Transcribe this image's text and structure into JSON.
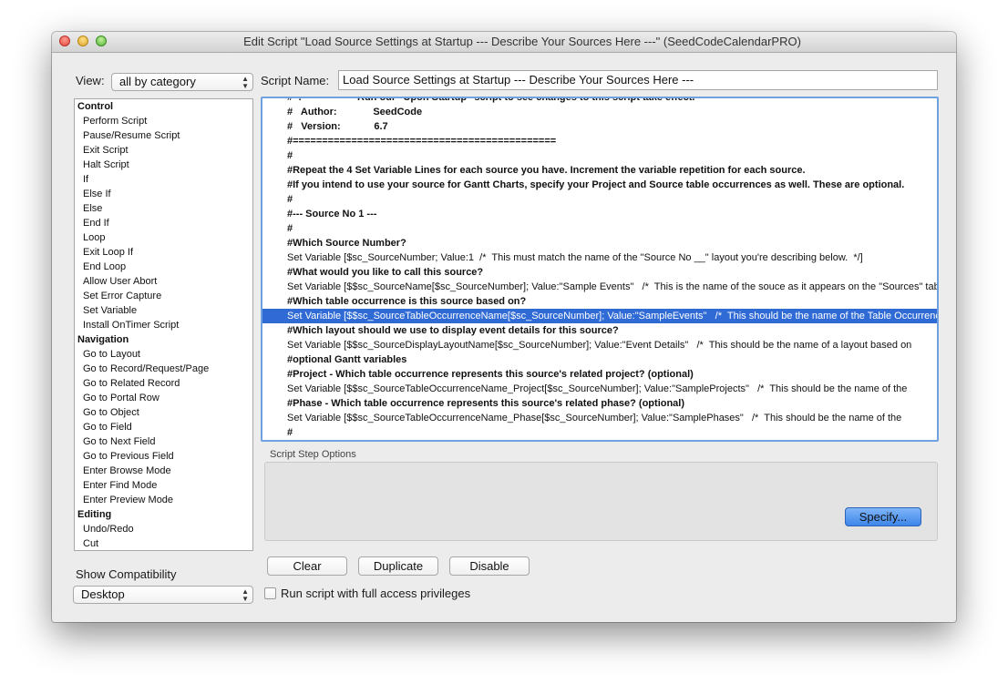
{
  "window": {
    "title": "Edit Script \"Load Source Settings at Startup --- Describe Your Sources Here ---\" (SeedCodeCalendarPRO)"
  },
  "view": {
    "label": "View:",
    "selected": "all by category"
  },
  "script_name": {
    "label": "Script Name:",
    "value": "Load Source Settings at Startup --- Describe Your Sources Here ---"
  },
  "steps": [
    {
      "label": "Control",
      "category": true
    },
    {
      "label": "Perform Script"
    },
    {
      "label": "Pause/Resume Script"
    },
    {
      "label": "Exit Script"
    },
    {
      "label": "Halt Script"
    },
    {
      "label": "If"
    },
    {
      "label": "Else If"
    },
    {
      "label": "Else"
    },
    {
      "label": "End If"
    },
    {
      "label": "Loop"
    },
    {
      "label": "Exit Loop If"
    },
    {
      "label": "End Loop"
    },
    {
      "label": "Allow User Abort"
    },
    {
      "label": "Set Error Capture"
    },
    {
      "label": "Set Variable"
    },
    {
      "label": "Install OnTimer Script"
    },
    {
      "label": "Navigation",
      "category": true
    },
    {
      "label": "Go to Layout"
    },
    {
      "label": "Go to Record/Request/Page"
    },
    {
      "label": "Go to Related Record"
    },
    {
      "label": "Go to Portal Row"
    },
    {
      "label": "Go to Object"
    },
    {
      "label": "Go to Field"
    },
    {
      "label": "Go to Next Field"
    },
    {
      "label": "Go to Previous Field"
    },
    {
      "label": "Enter Browse Mode"
    },
    {
      "label": "Enter Find Mode"
    },
    {
      "label": "Enter Preview Mode"
    },
    {
      "label": "Editing",
      "category": true
    },
    {
      "label": "Undo/Redo"
    },
    {
      "label": "Cut"
    }
  ],
  "script_lines": [
    {
      "text": "#  :                    Run our \"Upon Startup\" script to see changes to this script take effect.",
      "bold": true
    },
    {
      "text": "#   Author:             SeedCode",
      "bold": true
    },
    {
      "text": "#   Version:            6.7",
      "bold": true
    },
    {
      "text": "#=============================================",
      "bold": true
    },
    {
      "text": "#",
      "bold": true
    },
    {
      "text": "#Repeat the 4 Set Variable Lines for each source you have. Increment the variable repetition for each source.",
      "bold": true
    },
    {
      "text": "#If you intend to use your source for Gantt Charts, specify your Project and Source table occurrences as well. These are optional.",
      "bold": true
    },
    {
      "text": "#",
      "bold": true
    },
    {
      "text": "#--- Source No 1 ---",
      "bold": true
    },
    {
      "text": "#",
      "bold": true
    },
    {
      "text": "#Which Source Number?",
      "bold": true
    },
    {
      "text": "Set Variable [$sc_SourceNumber; Value:1  /*  This must match the name of the \"Source No __\" layout you're describing below.  */]"
    },
    {
      "text": "#What would you like to call this source?",
      "bold": true
    },
    {
      "text": "Set Variable [$$sc_SourceName[$sc_SourceNumber]; Value:\"Sample Events\"   /*  This is the name of the souce as it appears on the \"Sources\" tab."
    },
    {
      "text": "#Which table occurrence is this source based on?",
      "bold": true
    },
    {
      "text": "Set Variable [$$sc_SourceTableOccurrenceName[$sc_SourceNumber]; Value:\"SampleEvents\"   /*  This should be the name of the Table Occurrence",
      "selected": true
    },
    {
      "text": "#Which layout should we use to display event details for this source?",
      "bold": true
    },
    {
      "text": "Set Variable [$$sc_SourceDisplayLayoutName[$sc_SourceNumber]; Value:\"Event Details\"   /*  This should be the name of a layout based on"
    },
    {
      "text": "#optional Gantt variables",
      "bold": true
    },
    {
      "text": "#Project - Which table occurrence represents this source's related project? (optional)",
      "bold": true
    },
    {
      "text": "Set Variable [$$sc_SourceTableOccurrenceName_Project[$sc_SourceNumber]; Value:\"SampleProjects\"   /*  This should be the name of the"
    },
    {
      "text": "#Phase - Which table occurrence represents this source's related phase? (optional)",
      "bold": true
    },
    {
      "text": "Set Variable [$$sc_SourceTableOccurrenceName_Phase[$sc_SourceNumber]; Value:\"SamplePhases\"   /*  This should be the name of the"
    },
    {
      "text": "#",
      "bold": true
    }
  ],
  "options": {
    "label": "Script Step Options",
    "specify_label": "Specify..."
  },
  "buttons": {
    "clear": "Clear",
    "duplicate": "Duplicate",
    "disable": "Disable"
  },
  "compatibility": {
    "label": "Show Compatibility",
    "selected": "Desktop"
  },
  "privileges": {
    "label": "Run script with full access privileges",
    "checked": false
  },
  "colors": {
    "selection": "#2f6ad5",
    "focus_ring": "#6fa0df",
    "default_button": "#4a8eeb"
  }
}
